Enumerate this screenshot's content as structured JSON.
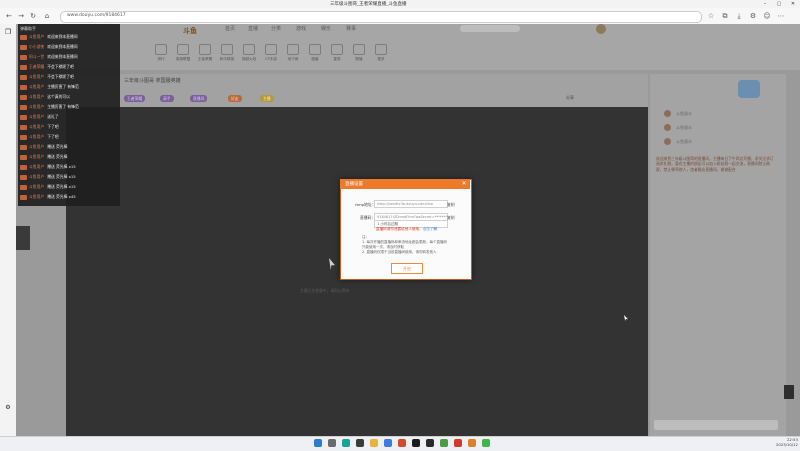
{
  "browser": {
    "title": "三年级斗图哥_王者荣耀直播_斗鱼直播",
    "url": "www.douyu.com/9184617",
    "back_icon": "arrow-left-icon",
    "refresh_icon": "refresh-icon"
  },
  "site": {
    "logo": "斗鱼",
    "nav": [
      "首页",
      "直播",
      "分类",
      "游戏",
      "娱乐",
      "赛事"
    ],
    "categories": [
      "排行",
      "英雄联盟",
      "王者荣耀",
      "和平精英",
      "穿越火线",
      "CF手游",
      "地下城",
      "魔兽",
      "星秀",
      "颜值",
      "更多"
    ]
  },
  "room": {
    "title": "三年级斗图哥 拿国服英雄",
    "tags": [
      "王者荣耀",
      "高手",
      "直播间",
      "好友",
      "主播"
    ],
    "share_label": "分享"
  },
  "danmaku": {
    "header": "弹幕助手",
    "messages": [
      {
        "user": "斗鱼用户",
        "text": "欢迎来到本直播间"
      },
      {
        "user": "小小游侠",
        "text": "欢迎来到本直播间"
      },
      {
        "user": "阿斗一世",
        "text": "欢迎来到本直播间"
      },
      {
        "user": "王者荣耀",
        "text": "不会下棋呢了吧"
      },
      {
        "user": "斗鱼用户",
        "text": "不会下棋呢了吧"
      },
      {
        "user": "斗鱼用户",
        "text": "主播厉害了 有锋范"
      },
      {
        "user": "斗鱼用户",
        "text": "这个真的可以"
      },
      {
        "user": "斗鱼用户",
        "text": "主播厉害了 有锋范"
      },
      {
        "user": "斗鱼用户",
        "text": "送礼了"
      },
      {
        "user": "斗鱼用户",
        "text": "下了吧"
      },
      {
        "user": "斗鱼用户",
        "text": "下了吧"
      },
      {
        "user": "斗鱼用户",
        "text": "赠送 荧光棒"
      },
      {
        "user": "斗鱼用户",
        "text": "赠送 荧光棒"
      },
      {
        "user": "斗鱼用户",
        "text": "赠送 荧光棒 x15"
      },
      {
        "user": "斗鱼用户",
        "text": "赠送 荧光棒 x15"
      },
      {
        "user": "斗鱼用户",
        "text": "赠送 荧光棒 x15"
      },
      {
        "user": "斗鱼用户",
        "text": "赠送 荧光棒 x45"
      }
    ]
  },
  "dialog": {
    "title": "直播设置",
    "close_icon": "close-icon",
    "rtmp_label": "rtmp地址：",
    "rtmp_value": "rtmp://sendtc3a.douyu.com/live",
    "key_label": "直播码：",
    "key_value": "9184617rZDvwdFhm?wsSecret=***********",
    "copy_label": "复制",
    "select_value": "1 小时后过期",
    "warning": "直播码请勿泄露给他人使用，",
    "warning_link": "点击了解",
    "notes": [
      "注：",
      "1. 每次开播的直播码和串流地址都会更新，每个直播码",
      "   只能使用一次，请及时获取",
      "2. 直播码仅限于当前直播间使用，请勿转发他人"
    ],
    "confirm_label": "开启"
  },
  "player": {
    "footer": "主播正在准备中，请耐心等待"
  },
  "right_panel": {
    "users": [
      "斗鱼观众",
      "斗鱼观众",
      "斗鱼观众"
    ],
    "notice": "欢迎来到三年级斗图哥的直播间，主播每日下午四点开播，求关注求订阅求礼物，喜欢主播的朋友可以加入粉丝群一起交流，直播间禁止刷屏，禁止辱骂他人，违者踢出直播间，谢谢配合"
  },
  "taskbar": {
    "time": "22:53",
    "date": "2023/10/12"
  }
}
